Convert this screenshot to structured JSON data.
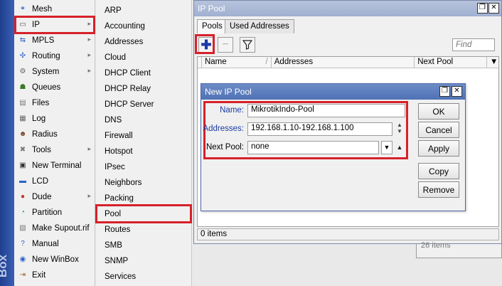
{
  "brand": {
    "text": "Box"
  },
  "main_menu": {
    "items": [
      {
        "label": "Mesh",
        "icon": "mesh-icon",
        "has_submenu": false
      },
      {
        "label": "IP",
        "icon": "ip-icon",
        "has_submenu": true,
        "selected": true
      },
      {
        "label": "MPLS",
        "icon": "mpls-icon",
        "has_submenu": true
      },
      {
        "label": "Routing",
        "icon": "routing-icon",
        "has_submenu": true
      },
      {
        "label": "System",
        "icon": "gear-icon",
        "has_submenu": true
      },
      {
        "label": "Queues",
        "icon": "queues-icon",
        "has_submenu": false
      },
      {
        "label": "Files",
        "icon": "folder-icon",
        "has_submenu": false
      },
      {
        "label": "Log",
        "icon": "log-icon",
        "has_submenu": false
      },
      {
        "label": "Radius",
        "icon": "radius-icon",
        "has_submenu": false
      },
      {
        "label": "Tools",
        "icon": "tools-icon",
        "has_submenu": true
      },
      {
        "label": "New Terminal",
        "icon": "terminal-icon",
        "has_submenu": false
      },
      {
        "label": "LCD",
        "icon": "lcd-icon",
        "has_submenu": false
      },
      {
        "label": "Dude",
        "icon": "dude-icon",
        "has_submenu": true
      },
      {
        "label": "Partition",
        "icon": "partition-icon",
        "has_submenu": false
      },
      {
        "label": "Make Supout.rif",
        "icon": "supout-icon",
        "has_submenu": false
      },
      {
        "label": "Manual",
        "icon": "help-icon",
        "has_submenu": false
      },
      {
        "label": "New WinBox",
        "icon": "winbox-icon",
        "has_submenu": false
      },
      {
        "label": "Exit",
        "icon": "exit-icon",
        "has_submenu": false
      }
    ]
  },
  "ip_submenu": {
    "items": [
      {
        "label": "ARP"
      },
      {
        "label": "Accounting"
      },
      {
        "label": "Addresses"
      },
      {
        "label": "Cloud"
      },
      {
        "label": "DHCP Client"
      },
      {
        "label": "DHCP Relay"
      },
      {
        "label": "DHCP Server"
      },
      {
        "label": "DNS"
      },
      {
        "label": "Firewall"
      },
      {
        "label": "Hotspot"
      },
      {
        "label": "IPsec"
      },
      {
        "label": "Neighbors"
      },
      {
        "label": "Packing"
      },
      {
        "label": "Pool",
        "selected": true
      },
      {
        "label": "Routes"
      },
      {
        "label": "SMB"
      },
      {
        "label": "SNMP"
      },
      {
        "label": "Services"
      }
    ]
  },
  "pool_window": {
    "title": "IP Pool",
    "tabs": [
      "Pools",
      "Used Addresses"
    ],
    "find_placeholder": "Find",
    "columns": [
      "Name",
      "Addresses",
      "Next Pool"
    ],
    "status": "0 items",
    "window_buttons": {
      "restore": "❐",
      "close": "✕"
    }
  },
  "bg_window": {
    "status": "26 items"
  },
  "new_pool_dialog": {
    "title": "New IP Pool",
    "fields": {
      "name": {
        "label": "Name:",
        "value": "MikrotikIndo-Pool"
      },
      "addresses": {
        "label": "Addresses:",
        "value": "192.168.1.10-192.168.1.100"
      },
      "next_pool": {
        "label": "Next Pool:",
        "value": "none"
      }
    },
    "buttons": [
      "OK",
      "Cancel",
      "Apply",
      "Copy",
      "Remove"
    ]
  },
  "colors": {
    "highlight": "#d7212a",
    "label_blue": "#1a3aa0",
    "add_blue": "#1b3aa8",
    "dialog_title": "#4f72b5"
  }
}
